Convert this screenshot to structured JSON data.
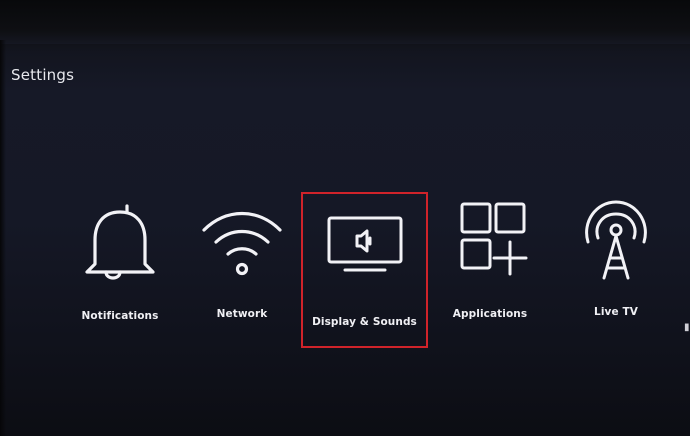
{
  "page": {
    "title": "Settings"
  },
  "menu": {
    "items": [
      {
        "label": "Notifications",
        "icon": "bell-icon"
      },
      {
        "label": "Network",
        "icon": "wifi-icon"
      },
      {
        "label": "Display & Sounds",
        "icon": "display-speaker-icon",
        "selected": true
      },
      {
        "label": "Applications",
        "icon": "apps-grid-plus-icon"
      },
      {
        "label": "Live TV",
        "icon": "antenna-tower-icon"
      }
    ]
  },
  "colors": {
    "selection_border": "#d0232a",
    "icon_stroke": "#f2f2f6",
    "background": "#151826"
  }
}
